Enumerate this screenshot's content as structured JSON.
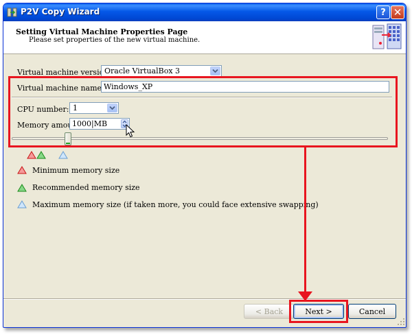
{
  "window": {
    "title": "P2V Copy Wizard",
    "help_glyph": "?",
    "close_glyph": "✕"
  },
  "header": {
    "title": "Setting Virtual Machine Properties Page",
    "subtitle": "Please set properties of the new virtual machine."
  },
  "form": {
    "version_label": "Virtual machine version:",
    "version_value": "Oracle VirtualBox 3",
    "name_label": "Virtual machine name:",
    "name_value": "Windows_XP",
    "cpu_label": "CPU number:",
    "cpu_value": "1",
    "memory_label": "Memory amount:",
    "memory_value": "1000|MB"
  },
  "memory_slider": {
    "level": 0.15
  },
  "legend": [
    {
      "icon": "red-triangle-icon",
      "label": "Minimum memory size"
    },
    {
      "icon": "green-triangle-icon",
      "label": "Recommended memory size"
    },
    {
      "icon": "blue-triangle-icon",
      "label": "Maximum memory size (if taken more, you could face extensive swapping)"
    }
  ],
  "buttons": {
    "back_label": "< Back",
    "next_label": "Next >",
    "cancel_label": "Cancel"
  },
  "colors": {
    "highlight": "#e8151f",
    "min": "#e8151f",
    "recommended": "#22b022",
    "max": "#7fb6ef"
  }
}
